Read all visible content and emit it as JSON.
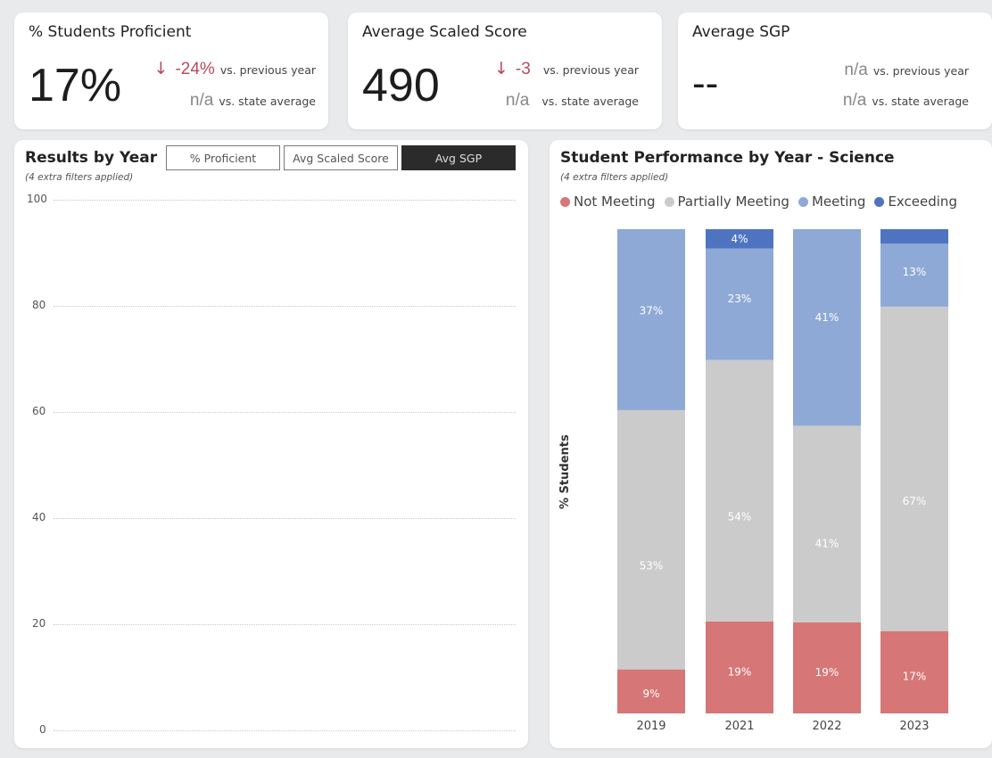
{
  "kpis": [
    {
      "title": "% Students Proficient",
      "value": "17%",
      "prev_delta": "-24%",
      "prev_label": "vs. previous year",
      "state_value": "n/a",
      "state_label": "vs. state average"
    },
    {
      "title": "Average Scaled Score",
      "value": "490",
      "prev_delta": "-3",
      "prev_label": "vs. previous year",
      "state_value": "n/a",
      "state_label": "vs. state average"
    },
    {
      "title": "Average SGP",
      "value": "--",
      "prev_value": "n/a",
      "prev_label": "vs. previous year",
      "state_value": "n/a",
      "state_label": "vs. state average"
    }
  ],
  "results_by_year": {
    "title": "Results by Year",
    "note": "(4 extra filters applied)",
    "toggles": [
      "% Proficient",
      "Avg Scaled Score",
      "Avg SGP"
    ],
    "active_toggle": 2,
    "y_ticks": [
      "100",
      "80",
      "60",
      "40",
      "20",
      "0"
    ]
  },
  "student_performance": {
    "title": "Student Performance by Year - Science",
    "note": "(4 extra filters applied)",
    "y_axis_title": "% Students",
    "legend": [
      "Not Meeting",
      "Partially Meeting",
      "Meeting",
      "Exceeding"
    ]
  },
  "colors": {
    "not_meeting": "#d67676",
    "partially_meeting": "#cbcbcb",
    "meeting": "#8ea9d6",
    "exceeding": "#4e74c1",
    "negative": "#b94a5a"
  },
  "chart_data": {
    "type": "bar",
    "stacked": true,
    "percent_stacked": true,
    "title": "Student Performance by Year - Science",
    "ylabel": "% Students",
    "categories": [
      "2019",
      "2021",
      "2022",
      "2023"
    ],
    "series": [
      {
        "name": "Not Meeting",
        "values": [
          9,
          19,
          19,
          17
        ],
        "labels": [
          "9%",
          "19%",
          "19%",
          "17%"
        ]
      },
      {
        "name": "Partially Meeting",
        "values": [
          53,
          54,
          41,
          67
        ],
        "labels": [
          "53%",
          "54%",
          "41%",
          "67%"
        ]
      },
      {
        "name": "Meeting",
        "values": [
          37,
          23,
          41,
          13
        ],
        "labels": [
          "37%",
          "23%",
          "41%",
          "13%"
        ]
      },
      {
        "name": "Exceeding",
        "values": [
          0,
          4,
          0,
          3
        ],
        "labels": [
          "",
          "4%",
          "",
          ""
        ]
      }
    ],
    "legend_position": "top-left",
    "ylim": [
      0,
      100
    ]
  }
}
